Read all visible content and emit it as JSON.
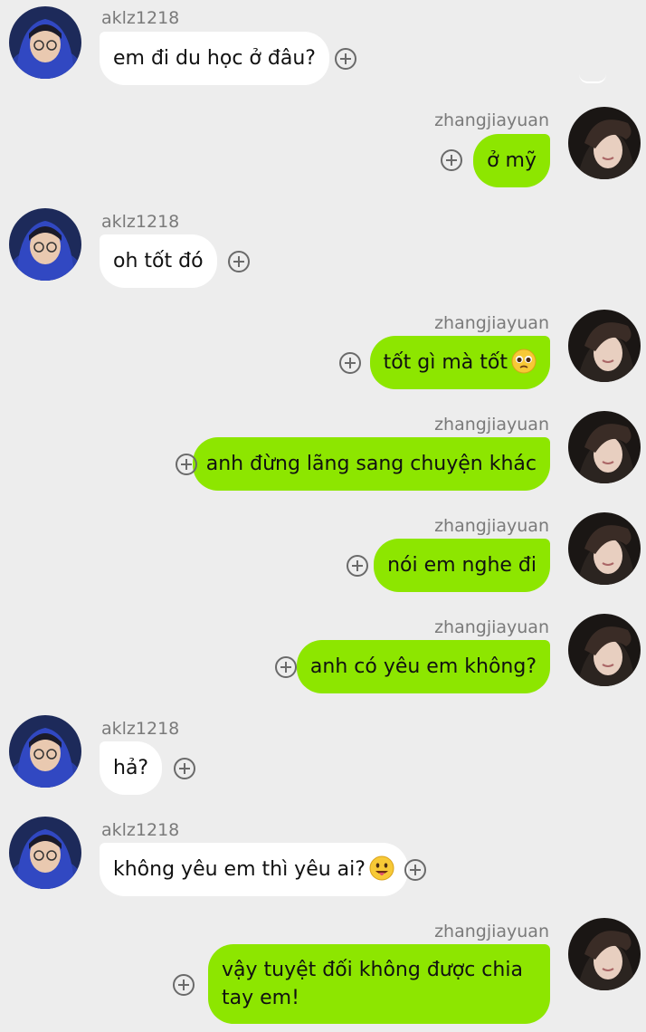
{
  "users": {
    "other": {
      "name": "aklz1218",
      "avatar_icon": "avatar-aklz1218-icon"
    },
    "self": {
      "name": "zhangjiayuan",
      "avatar_icon": "avatar-zhangjiayuan-icon"
    }
  },
  "colors": {
    "background": "#ededed",
    "bubble_self": "#8de600",
    "bubble_other": "#ffffff",
    "name_text": "#7a7a7a"
  },
  "messages": [
    {
      "sender": "aklz1218",
      "text": "em đi du học ở đâu?"
    },
    {
      "sender": "zhangjiayuan",
      "text": "ở mỹ"
    },
    {
      "sender": "aklz1218",
      "text": "oh tốt đó"
    },
    {
      "sender": "zhangjiayuan",
      "text": "tốt gì mà tốt",
      "emoji": "pleading-face-emoji"
    },
    {
      "sender": "zhangjiayuan",
      "text": "anh đừng lãng sang chuyện khác"
    },
    {
      "sender": "zhangjiayuan",
      "text": "nói em nghe đi"
    },
    {
      "sender": "zhangjiayuan",
      "text": "anh có yêu em không?"
    },
    {
      "sender": "aklz1218",
      "text": "hả?"
    },
    {
      "sender": "aklz1218",
      "text": "không yêu em thì yêu ai?",
      "emoji": "grinning-tongue-emoji"
    },
    {
      "sender": "zhangjiayuan",
      "text": "vậy tuyệt đối không được chia tay em!"
    }
  ]
}
